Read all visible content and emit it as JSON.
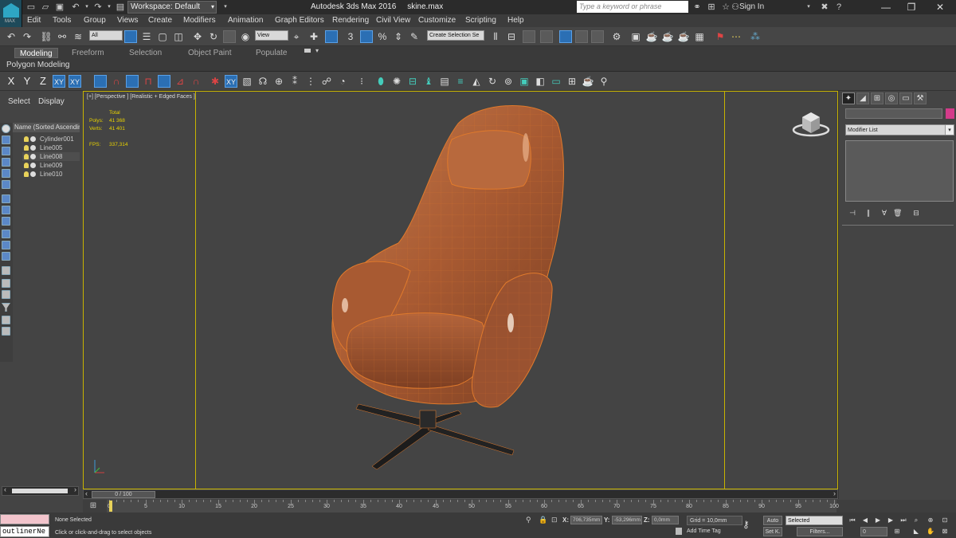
{
  "titlebar": {
    "logo": "MAX",
    "workspace": "Workspace: Default",
    "title": "Autodesk 3ds Max 2016",
    "filename": "skine.max",
    "search_placeholder": "Type a keyword or phrase",
    "signin": "Sign In"
  },
  "menu": [
    "Edit",
    "Tools",
    "Group",
    "Views",
    "Create",
    "Modifiers",
    "Animation",
    "Graph Editors",
    "Rendering",
    "Civil View",
    "Customize",
    "Scripting",
    "Help"
  ],
  "toolbar": {
    "filter": "All",
    "refcoord": "View",
    "selset": "Create Selection Se",
    "snap_num": "3"
  },
  "ribbon": {
    "tabs": [
      "Modeling",
      "Freeform",
      "Selection",
      "Object Paint",
      "Populate"
    ],
    "active": "Modeling",
    "sub": "Polygon Modeling"
  },
  "axes": [
    "X",
    "Y",
    "Z",
    "XY",
    "XY"
  ],
  "explorer": {
    "tabs": [
      "Select",
      "Display"
    ],
    "column": "Name (Sorted Ascending)",
    "items": [
      "Cylinder001",
      "Line005",
      "Line008",
      "Line009",
      "Line010"
    ]
  },
  "viewport": {
    "label": "[+] [Perspective ] [Realistic + Edged Faces ]",
    "stats": {
      "total_label": "Total",
      "polys_label": "Polys:",
      "polys": "41 368",
      "verts_label": "Verts:",
      "verts": "41 401",
      "fps_label": "FPS:",
      "fps": "337,314"
    }
  },
  "command_panel": {
    "modifier_list": "Modifier List"
  },
  "timeslider": {
    "label": "0 / 100",
    "ticks": [
      0,
      5,
      10,
      15,
      20,
      25,
      30,
      35,
      40,
      45,
      50,
      55,
      60,
      65,
      70,
      75,
      80,
      85,
      90,
      95,
      100
    ]
  },
  "status": {
    "maxscript_value": "outlinerNe",
    "selection": "None Selected",
    "prompt": "Click or click-and-drag to select objects",
    "x_label": "X:",
    "x": "706,735mm",
    "y_label": "Y:",
    "y": "-53,296mm",
    "z_label": "Z:",
    "z": "0,0mm",
    "grid": "Grid = 10,0mm",
    "add_time_tag": "Add Time Tag",
    "auto": "Auto",
    "setk": "Set K.",
    "selected": "Selected",
    "filters": "Filters...",
    "frame": "0"
  },
  "colors": {
    "accent": "#2b6fb4",
    "viewport_border": "#c8b400",
    "chair": "#b5633a",
    "stats": "#e8d200"
  }
}
